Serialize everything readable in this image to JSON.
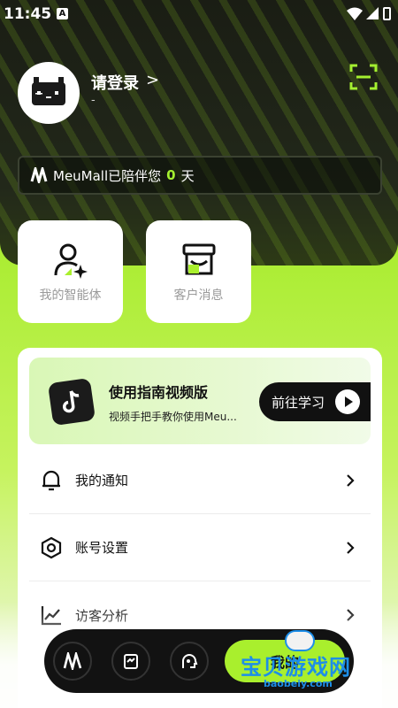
{
  "status_bar": {
    "time": "11:45",
    "app_badge": "A"
  },
  "user": {
    "login_label": "请登录",
    "login_arrow": ">",
    "subtitle": "-"
  },
  "accompany": {
    "prefix": "MeuMall已陪伴您",
    "days": "0",
    "suffix": "天"
  },
  "shortcuts": [
    {
      "label": "我的智能体",
      "icon": "agent-user-icon"
    },
    {
      "label": "客户消息",
      "icon": "store-icon"
    }
  ],
  "guide": {
    "title": "使用指南视频版",
    "subtitle": "视频手把手教你使用Meu...",
    "button_label": "前往学习"
  },
  "menu": [
    {
      "label": "我的通知",
      "icon": "bell-icon"
    },
    {
      "label": "账号设置",
      "icon": "hexagon-settings-icon"
    },
    {
      "label": "访客分析",
      "icon": "chart-line-icon"
    }
  ],
  "tabbar": {
    "mine_label": "我的"
  },
  "watermark": {
    "text": "宝贝游戏网",
    "url": "baobeiy.com"
  },
  "colors": {
    "accent": "#a9ef2d",
    "dark": "#121212"
  }
}
